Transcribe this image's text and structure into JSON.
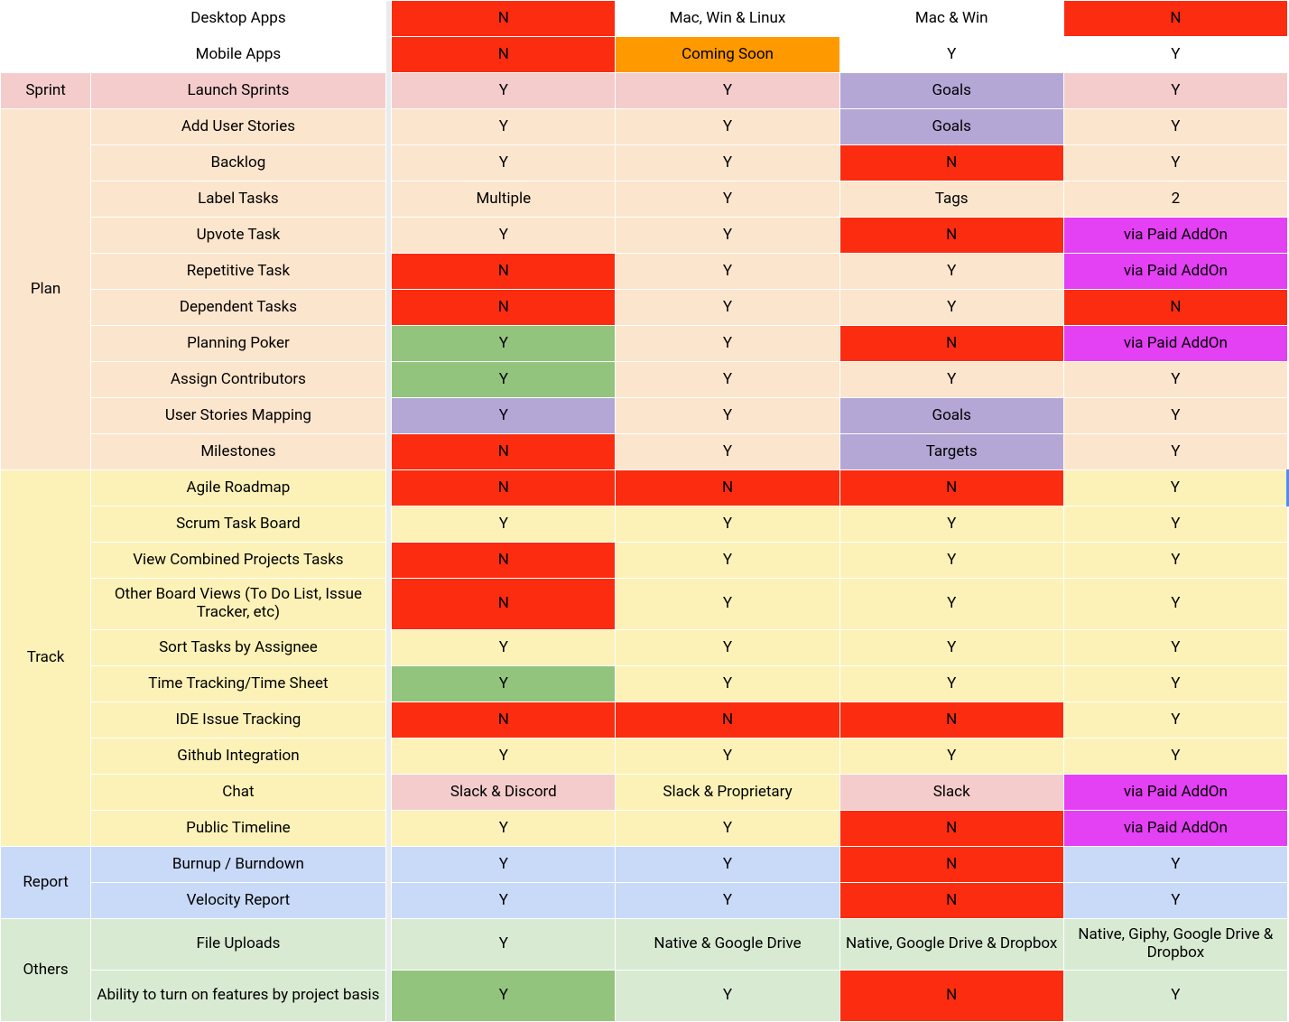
{
  "categories": {
    "sprint": "Sprint",
    "plan": "Plan",
    "track": "Track",
    "report": "Report",
    "others": "Others"
  },
  "rows": [
    {
      "cat": "",
      "catClass": "white",
      "feat": "Desktop Apps",
      "c": [
        "N",
        "Mac, Win & Linux",
        "Mac & Win",
        "N"
      ],
      "cc": [
        "red",
        "white",
        "white",
        "red"
      ]
    },
    {
      "cat": "",
      "catClass": "white",
      "feat": "Mobile Apps",
      "c": [
        "N",
        "Coming Soon",
        "Y",
        "Y"
      ],
      "cc": [
        "red",
        "orange",
        "white",
        "white"
      ]
    },
    {
      "cat": "Sprint",
      "catClass": "pink",
      "feat": "Launch Sprints",
      "c": [
        "Y",
        "Y",
        "Goals",
        "Y"
      ],
      "cc": [
        "pink",
        "pink",
        "purple",
        "pink"
      ]
    },
    {
      "cat": "Plan",
      "catClass": "peach",
      "feat": "Add User Stories",
      "c": [
        "Y",
        "Y",
        "Goals",
        "Y"
      ],
      "cc": [
        "peach",
        "peach",
        "purple",
        "peach"
      ]
    },
    {
      "feat": "Backlog",
      "c": [
        "Y",
        "Y",
        "N",
        "Y"
      ],
      "cc": [
        "peach",
        "peach",
        "red",
        "peach"
      ]
    },
    {
      "feat": "Label Tasks",
      "c": [
        "Multiple",
        "Y",
        "Tags",
        "2"
      ],
      "cc": [
        "peach",
        "peach",
        "peach",
        "peach"
      ]
    },
    {
      "feat": "Upvote Task",
      "c": [
        "Y",
        "Y",
        "N",
        "via Paid AddOn"
      ],
      "cc": [
        "peach",
        "peach",
        "red",
        "magenta"
      ]
    },
    {
      "feat": "Repetitive Task",
      "c": [
        "N",
        "Y",
        "Y",
        "via Paid AddOn"
      ],
      "cc": [
        "red",
        "peach",
        "peach",
        "magenta"
      ]
    },
    {
      "feat": "Dependent Tasks",
      "c": [
        "N",
        "Y",
        "Y",
        "N"
      ],
      "cc": [
        "red",
        "peach",
        "peach",
        "red"
      ]
    },
    {
      "feat": "Planning Poker",
      "c": [
        "Y",
        "Y",
        "N",
        "via Paid AddOn"
      ],
      "cc": [
        "green",
        "peach",
        "red",
        "magenta"
      ]
    },
    {
      "feat": "Assign Contributors",
      "c": [
        "Y",
        "Y",
        "Y",
        "Y"
      ],
      "cc": [
        "green",
        "peach",
        "peach",
        "peach"
      ]
    },
    {
      "feat": "User Stories Mapping",
      "c": [
        "Y",
        "Y",
        "Goals",
        "Y"
      ],
      "cc": [
        "purple",
        "peach",
        "purple",
        "peach"
      ]
    },
    {
      "feat": "Milestones",
      "c": [
        "N",
        "Y",
        "Targets",
        "Y"
      ],
      "cc": [
        "red",
        "peach",
        "purple",
        "peach"
      ]
    },
    {
      "cat": "Track",
      "catClass": "yellow",
      "feat": "Agile Roadmap",
      "c": [
        "N",
        "N",
        "N",
        "Y"
      ],
      "cc": [
        "red",
        "red",
        "red",
        "yellow"
      ],
      "lastExtra": "bluesel-right"
    },
    {
      "feat": "Scrum Task Board",
      "c": [
        "Y",
        "Y",
        "Y",
        "Y"
      ],
      "cc": [
        "yellow",
        "yellow",
        "yellow",
        "yellow"
      ]
    },
    {
      "feat": "View Combined Projects Tasks",
      "c": [
        "N",
        "Y",
        "Y",
        "Y"
      ],
      "cc": [
        "red",
        "yellow",
        "yellow",
        "yellow"
      ]
    },
    {
      "feat": "Other Board Views (To Do List, Issue Tracker, etc)",
      "c": [
        "N",
        "Y",
        "Y",
        "Y"
      ],
      "cc": [
        "red",
        "yellow",
        "yellow",
        "yellow"
      ],
      "tall": true
    },
    {
      "feat": "Sort Tasks by Assignee",
      "c": [
        "Y",
        "Y",
        "Y",
        "Y"
      ],
      "cc": [
        "yellow",
        "yellow",
        "yellow",
        "yellow"
      ]
    },
    {
      "feat": "Time Tracking/Time Sheet",
      "c": [
        "Y",
        "Y",
        "Y",
        "Y"
      ],
      "cc": [
        "green",
        "yellow",
        "yellow",
        "yellow"
      ]
    },
    {
      "feat": "IDE Issue Tracking",
      "c": [
        "N",
        "N",
        "N",
        "Y"
      ],
      "cc": [
        "red",
        "red",
        "red",
        "yellow"
      ]
    },
    {
      "feat": "Github Integration",
      "c": [
        "Y",
        "Y",
        "Y",
        "Y"
      ],
      "cc": [
        "yellow",
        "yellow",
        "yellow",
        "yellow"
      ]
    },
    {
      "feat": "Chat",
      "c": [
        "Slack & Discord",
        "Slack & Proprietary",
        "Slack",
        "via Paid AddOn"
      ],
      "cc": [
        "pink",
        "yellow",
        "pink",
        "magenta"
      ]
    },
    {
      "feat": "Public Timeline",
      "c": [
        "Y",
        "Y",
        "N",
        "via Paid AddOn"
      ],
      "cc": [
        "yellow",
        "yellow",
        "red",
        "magenta"
      ]
    },
    {
      "cat": "Report",
      "catClass": "blue",
      "feat": "Burnup / Burndown",
      "c": [
        "Y",
        "Y",
        "N",
        "Y"
      ],
      "cc": [
        "blue",
        "blue",
        "red",
        "blue"
      ]
    },
    {
      "feat": "Velocity Report",
      "c": [
        "Y",
        "Y",
        "N",
        "Y"
      ],
      "cc": [
        "blue",
        "blue",
        "red",
        "blue"
      ]
    },
    {
      "cat": "Others",
      "catClass": "mint",
      "feat": "File Uploads",
      "c": [
        "Y",
        "Native & Google Drive",
        "Native, Google Drive & Dropbox",
        "Native, Giphy, Google Drive & Dropbox"
      ],
      "cc": [
        "mint",
        "mint",
        "mint",
        "mint"
      ],
      "tall": true
    },
    {
      "feat": "Ability to turn on features by project basis",
      "c": [
        "Y",
        "Y",
        "N",
        "Y"
      ],
      "cc": [
        "green",
        "mint",
        "red",
        "mint"
      ],
      "tall": true
    }
  ],
  "groups": [
    {
      "start": 0,
      "span": 2,
      "class": "white",
      "label": ""
    },
    {
      "start": 2,
      "span": 1,
      "class": "pink",
      "label": "Sprint"
    },
    {
      "start": 3,
      "span": 10,
      "class": "peach",
      "label": "Plan"
    },
    {
      "start": 13,
      "span": 10,
      "class": "yellow",
      "label": "Track"
    },
    {
      "start": 23,
      "span": 2,
      "class": "blue",
      "label": "Report"
    },
    {
      "start": 25,
      "span": 2,
      "class": "mint",
      "label": "Others"
    }
  ]
}
